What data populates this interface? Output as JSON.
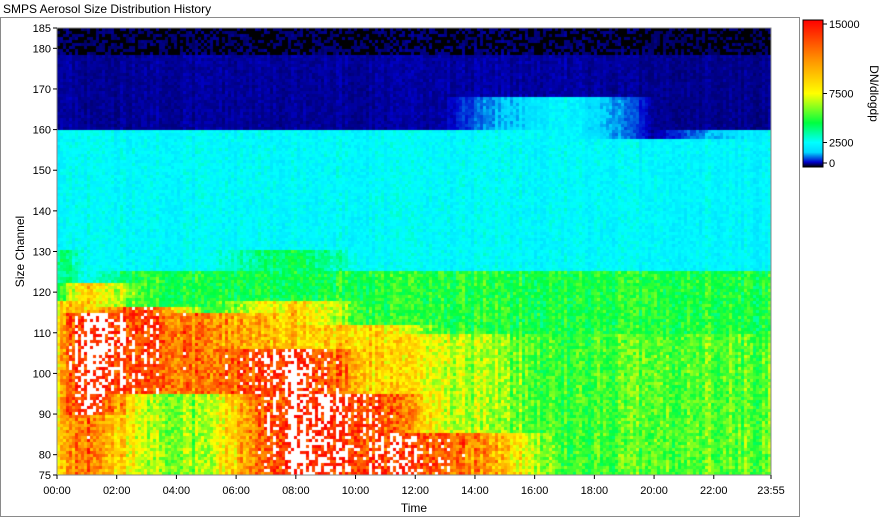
{
  "window": {
    "title": "SMPS Aerosol Size Distribution History"
  },
  "chart_data": {
    "type": "heatmap",
    "title": "SMPS Aerosol Size Distribution History",
    "xlabel": "Time",
    "ylabel": "Size Channel",
    "colorbar_label": "DN/dlogdp",
    "x_ticks": [
      "00:00",
      "02:00",
      "04:00",
      "06:00",
      "08:00",
      "10:00",
      "12:00",
      "14:00",
      "16:00",
      "18:00",
      "20:00",
      "22:00",
      "23:55"
    ],
    "x_tick_hours": [
      0,
      2,
      4,
      6,
      8,
      10,
      12,
      14,
      16,
      18,
      20,
      22,
      23.9167
    ],
    "xlim_hours": [
      0,
      23.9167
    ],
    "y_ticks": [
      75,
      80,
      90,
      100,
      110,
      120,
      130,
      140,
      150,
      160,
      170,
      180,
      185
    ],
    "ylim": [
      75,
      185
    ],
    "colorbar_ticks": [
      {
        "label": "15000",
        "value": 15000
      },
      {
        "label": "7500",
        "value": 7500
      },
      {
        "label": "2500",
        "value": 2500
      },
      {
        "label": "0",
        "value": 0
      }
    ],
    "colorbar_range": [
      0,
      15000
    ],
    "colorscale": [
      {
        "v": 0,
        "c": "#000000"
      },
      {
        "v": 500,
        "c": "#0000cc"
      },
      {
        "v": 1500,
        "c": "#00d8ff"
      },
      {
        "v": 2500,
        "c": "#00ffff"
      },
      {
        "v": 4500,
        "c": "#00ff40"
      },
      {
        "v": 7500,
        "c": "#ffff00"
      },
      {
        "v": 11000,
        "c": "#ff9000"
      },
      {
        "v": 15000,
        "c": "#ff0000"
      },
      {
        "v": 15001,
        "c": "#ffffff"
      }
    ],
    "profiles": [
      {
        "hour": 0,
        "bands": [
          {
            "from": 75,
            "to": 118,
            "value": 9000
          },
          {
            "from": 118,
            "to": 130,
            "value": 4200
          },
          {
            "from": 130,
            "to": 160,
            "value": 2300
          },
          {
            "from": 160,
            "to": 185,
            "value": 400
          }
        ]
      },
      {
        "hour": 1,
        "bands": [
          {
            "from": 75,
            "to": 90,
            "value": 12000
          },
          {
            "from": 90,
            "to": 115,
            "value": 16000
          },
          {
            "from": 115,
            "to": 122,
            "value": 9000
          },
          {
            "from": 122,
            "to": 160,
            "value": 2500
          },
          {
            "from": 160,
            "to": 185,
            "value": 350
          }
        ]
      },
      {
        "hour": 3,
        "bands": [
          {
            "from": 75,
            "to": 95,
            "value": 6500
          },
          {
            "from": 95,
            "to": 116,
            "value": 13500
          },
          {
            "from": 116,
            "to": 125,
            "value": 5000
          },
          {
            "from": 125,
            "to": 160,
            "value": 2400
          },
          {
            "from": 160,
            "to": 185,
            "value": 380
          }
        ]
      },
      {
        "hour": 5,
        "bands": [
          {
            "from": 75,
            "to": 95,
            "value": 6000
          },
          {
            "from": 95,
            "to": 115,
            "value": 11000
          },
          {
            "from": 115,
            "to": 125,
            "value": 4500
          },
          {
            "from": 125,
            "to": 160,
            "value": 2400
          },
          {
            "from": 160,
            "to": 185,
            "value": 380
          }
        ]
      },
      {
        "hour": 8,
        "bands": [
          {
            "from": 75,
            "to": 106,
            "value": 16000
          },
          {
            "from": 106,
            "to": 118,
            "value": 9000
          },
          {
            "from": 118,
            "to": 130,
            "value": 4500
          },
          {
            "from": 130,
            "to": 160,
            "value": 2400
          },
          {
            "from": 160,
            "to": 185,
            "value": 380
          }
        ]
      },
      {
        "hour": 10.5,
        "bands": [
          {
            "from": 75,
            "to": 95,
            "value": 14000
          },
          {
            "from": 95,
            "to": 112,
            "value": 9000
          },
          {
            "from": 112,
            "to": 125,
            "value": 4800
          },
          {
            "from": 125,
            "to": 160,
            "value": 2400
          },
          {
            "from": 160,
            "to": 185,
            "value": 380
          }
        ]
      },
      {
        "hour": 13,
        "bands": [
          {
            "from": 75,
            "to": 85,
            "value": 13000
          },
          {
            "from": 85,
            "to": 110,
            "value": 7000
          },
          {
            "from": 110,
            "to": 125,
            "value": 4800
          },
          {
            "from": 125,
            "to": 160,
            "value": 2400
          },
          {
            "from": 160,
            "to": 185,
            "value": 400
          }
        ]
      },
      {
        "hour": 17,
        "bands": [
          {
            "from": 75,
            "to": 110,
            "value": 5000
          },
          {
            "from": 110,
            "to": 125,
            "value": 4600
          },
          {
            "from": 125,
            "to": 168,
            "value": 2400
          },
          {
            "from": 168,
            "to": 185,
            "value": 400
          }
        ]
      },
      {
        "hour": 20,
        "bands": [
          {
            "from": 75,
            "to": 110,
            "value": 5500
          },
          {
            "from": 110,
            "to": 125,
            "value": 4800
          },
          {
            "from": 125,
            "to": 158,
            "value": 2300
          },
          {
            "from": 158,
            "to": 185,
            "value": 350
          }
        ]
      },
      {
        "hour": 23.9167,
        "bands": [
          {
            "from": 75,
            "to": 110,
            "value": 5500
          },
          {
            "from": 110,
            "to": 125,
            "value": 4700
          },
          {
            "from": 125,
            "to": 160,
            "value": 2300
          },
          {
            "from": 160,
            "to": 185,
            "value": 350
          }
        ]
      }
    ]
  }
}
